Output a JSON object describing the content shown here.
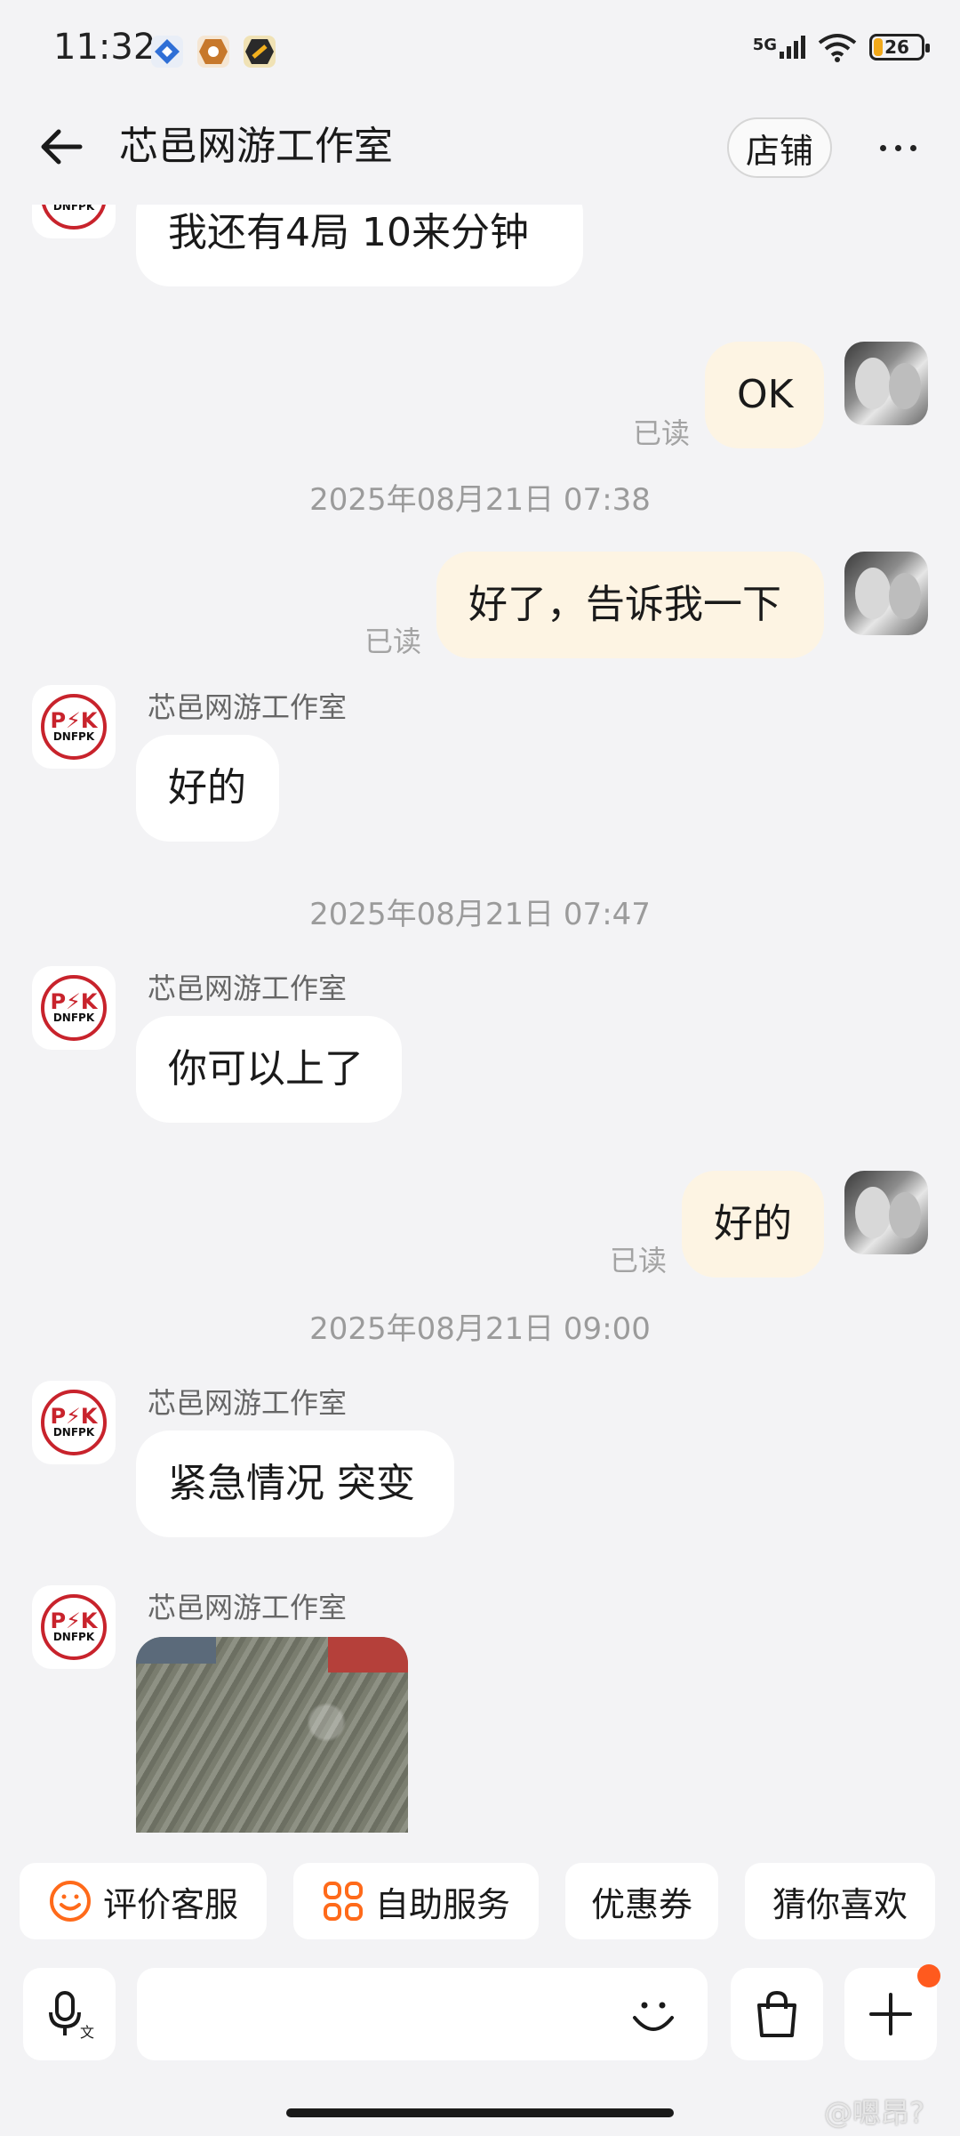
{
  "status_bar": {
    "time": "11:32",
    "network": "5G",
    "battery": "26"
  },
  "header": {
    "title": "芯邑网游工作室",
    "shop_button": "店铺"
  },
  "messages": {
    "m1": "我还有4局  10来分钟",
    "m2": "OK",
    "m2_status": "已读",
    "t1": "2025年08月21日 07:38",
    "m3": "好了，告诉我一下",
    "m3_status": "已读",
    "m4_sender": "芯邑网游工作室",
    "m4": "好的",
    "t2": "2025年08月21日 07:47",
    "m5_sender": "芯邑网游工作室",
    "m5": "你可以上了",
    "m6": "好的",
    "m6_status": "已读",
    "t3": "2025年08月21日 09:00",
    "m7_sender": "芯邑网游工作室",
    "m7": "紧急情况 突变",
    "m8_sender": "芯邑网游工作室"
  },
  "shop_logo": {
    "line1": "P⚡K",
    "line2": "DNFPK"
  },
  "quick_actions": {
    "rate": "评价客服",
    "self_service": "自助服务",
    "coupon": "优惠券",
    "guess": "猜你喜欢"
  },
  "input": {
    "placeholder": ""
  },
  "watermark": "@嗯昂?",
  "colors": {
    "accent": "#ff5a1e",
    "outgoing_bubble": "#fdf4e3",
    "incoming_bubble": "#ffffff",
    "background": "#f3f3f5"
  }
}
